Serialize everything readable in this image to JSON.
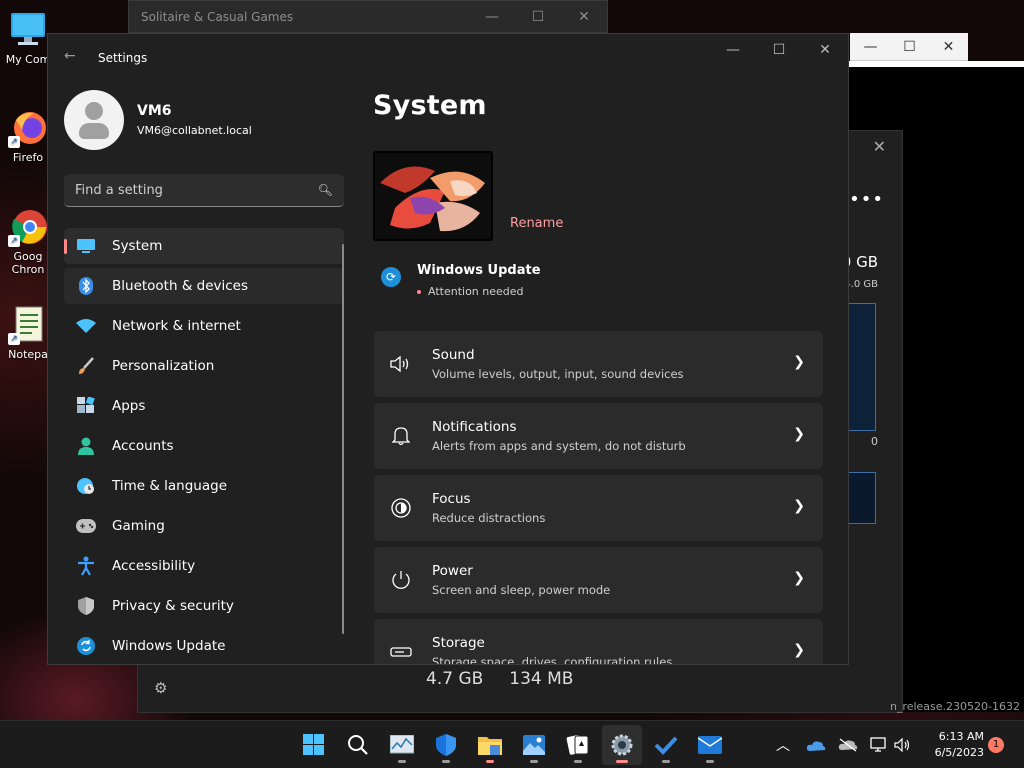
{
  "desktop": {
    "icons": [
      {
        "label": "My Com",
        "icon": "computer-icon"
      },
      {
        "label": "Firefo",
        "icon": "firefox-icon"
      },
      {
        "label": "Goog Chron",
        "icon": "chrome-icon"
      },
      {
        "label": "Notepa",
        "icon": "notepad-icon"
      }
    ]
  },
  "background_windows": {
    "solitaire_title": "Solitaire & Casual Games",
    "taskmgr": {
      "gb_big": "0 GB",
      "gb_small": "4.0 GB",
      "graph_zero": "0",
      "stat1": "4.7 GB",
      "stat2": "134 MB"
    },
    "build_text": "n_release.230520-1632"
  },
  "settings": {
    "title": "Settings",
    "profile": {
      "name": "VM6",
      "email": "VM6@collabnet.local"
    },
    "search": {
      "placeholder": "Find a setting"
    },
    "nav": [
      {
        "label": "System",
        "icon": "system-display-icon",
        "color": "#4cc2ff",
        "selected": true
      },
      {
        "label": "Bluetooth & devices",
        "icon": "bluetooth-icon",
        "color": "#4cc2ff"
      },
      {
        "label": "Network & internet",
        "icon": "wifi-icon",
        "color": "#4cc2ff"
      },
      {
        "label": "Personalization",
        "icon": "paintbrush-icon",
        "color": "#e8a060"
      },
      {
        "label": "Apps",
        "icon": "apps-icon",
        "color": "#a0b8d0"
      },
      {
        "label": "Accounts",
        "icon": "person-icon",
        "color": "#2fc49e"
      },
      {
        "label": "Time & language",
        "icon": "globe-clock-icon",
        "color": "#4cc2ff"
      },
      {
        "label": "Gaming",
        "icon": "gamepad-icon",
        "color": "#c0c0c0"
      },
      {
        "label": "Accessibility",
        "icon": "accessibility-icon",
        "color": "#3fa0ff"
      },
      {
        "label": "Privacy & security",
        "icon": "shield-icon",
        "color": "#a0a0a0"
      },
      {
        "label": "Windows Update",
        "icon": "update-icon",
        "color": "#1e90d8"
      }
    ],
    "main": {
      "page_title": "System",
      "rename_label": "Rename",
      "update": {
        "title": "Windows Update",
        "status": "Attention needed"
      },
      "cards": [
        {
          "title": "Sound",
          "subtitle": "Volume levels, output, input, sound devices",
          "icon": "speaker-icon"
        },
        {
          "title": "Notifications",
          "subtitle": "Alerts from apps and system, do not disturb",
          "icon": "bell-icon"
        },
        {
          "title": "Focus",
          "subtitle": "Reduce distractions",
          "icon": "focus-icon"
        },
        {
          "title": "Power",
          "subtitle": "Screen and sleep, power mode",
          "icon": "power-icon"
        },
        {
          "title": "Storage",
          "subtitle": "Storage space, drives, configuration rules",
          "icon": "storage-icon"
        }
      ]
    }
  },
  "taskbar": {
    "apps": [
      {
        "name": "start-icon"
      },
      {
        "name": "search-icon"
      },
      {
        "name": "resource-monitor-icon"
      },
      {
        "name": "defender-icon"
      },
      {
        "name": "file-explorer-icon"
      },
      {
        "name": "photos-icon"
      },
      {
        "name": "solitaire-icon"
      },
      {
        "name": "settings-icon",
        "active": true
      },
      {
        "name": "todo-icon"
      },
      {
        "name": "mail-icon"
      }
    ],
    "time": "6:13 AM",
    "date": "6/5/2023",
    "notifications": "1"
  }
}
